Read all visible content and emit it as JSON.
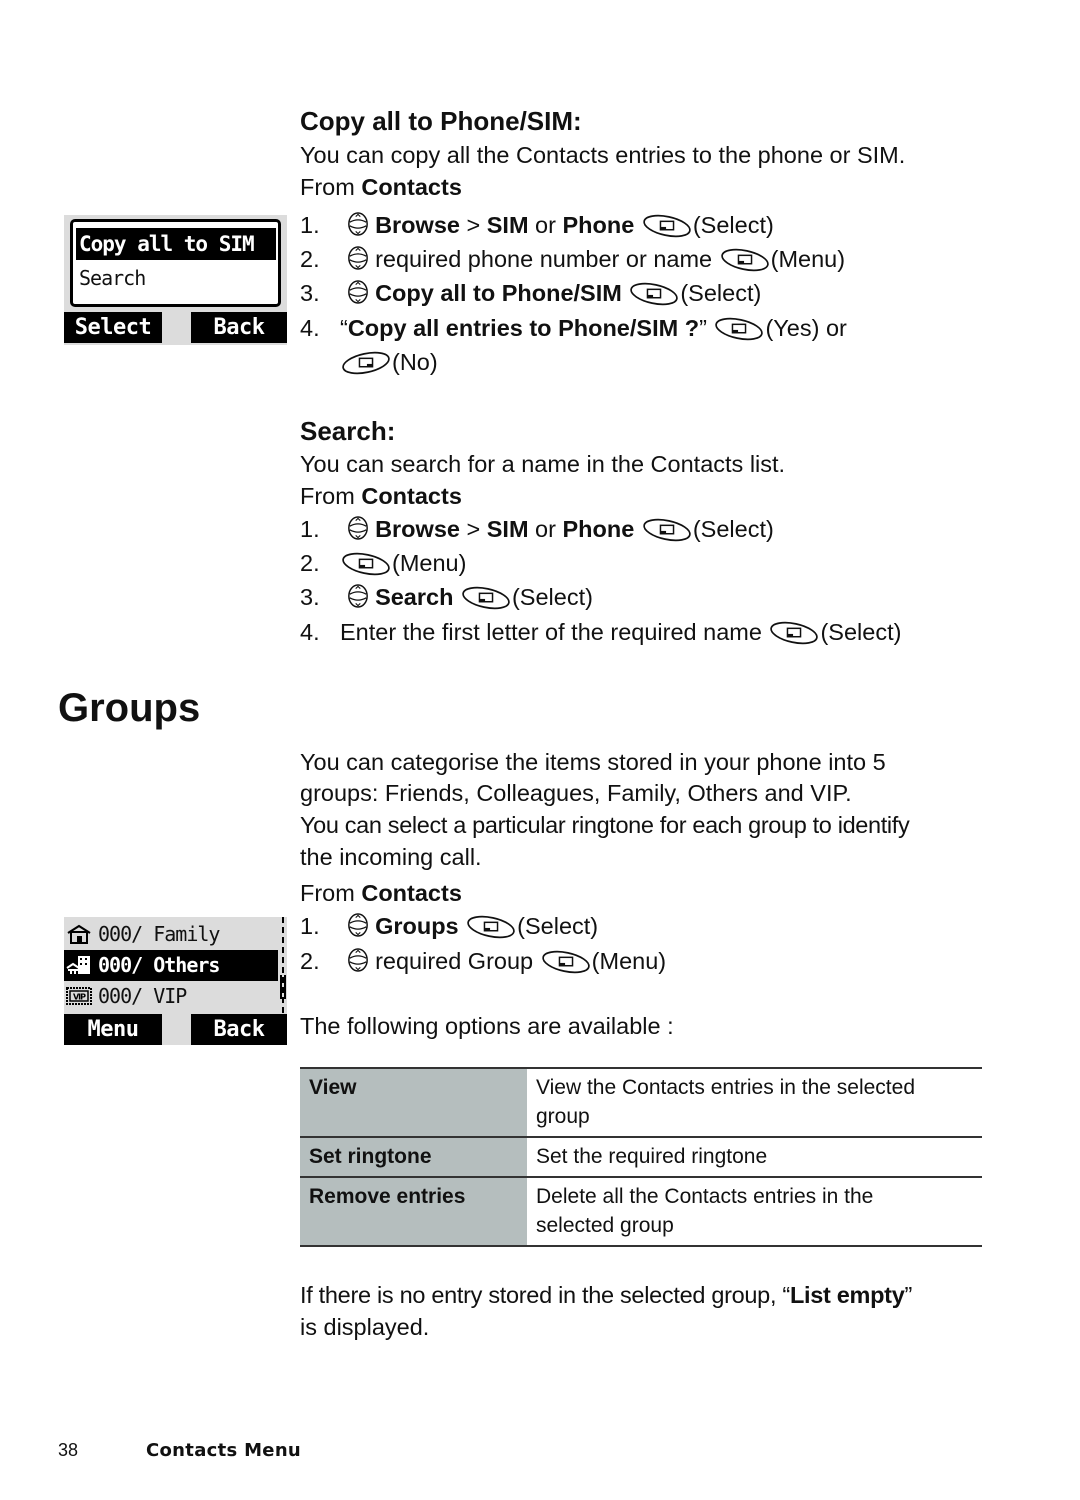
{
  "copy_section": {
    "heading": "Copy all to Phone/SIM:",
    "intro": "You can copy all the Contacts entries to the phone or SIM.",
    "from_prefix": "From ",
    "from_bold": "Contacts",
    "steps": [
      {
        "num": "1.",
        "nav_icon": "navigation-key-icon",
        "parts": [
          [
            "b",
            "Browse"
          ],
          [
            "t",
            " > "
          ],
          [
            "b",
            "SIM"
          ],
          [
            "t",
            " or "
          ],
          [
            "b",
            "Phone"
          ]
        ],
        "softkey": "left-softkey-icon",
        "action": "(Select)"
      },
      {
        "num": "2.",
        "nav_icon": "navigation-key-icon",
        "parts": [
          [
            "t",
            "required phone number or name"
          ]
        ],
        "softkey": "left-softkey-icon",
        "action": "(Menu)"
      },
      {
        "num": "3.",
        "nav_icon": "navigation-key-icon",
        "parts": [
          [
            "b",
            "Copy all to Phone/SIM"
          ]
        ],
        "softkey": "left-softkey-icon",
        "action": "(Select)"
      },
      {
        "num": "4.",
        "quote_open": "“",
        "bold": "Copy all entries to Phone/SIM ?",
        "quote_close": "”",
        "softkey": "left-softkey-icon",
        "action": "(Yes) or",
        "second_softkey": "right-softkey-icon",
        "second_action": "(No)"
      }
    ],
    "screen": {
      "highlighted": "Copy all to SIM",
      "item": "Search",
      "left_softkey": "Select",
      "right_softkey": "Back"
    }
  },
  "search_section": {
    "heading": "Search:",
    "intro": "You can search for a name in the Contacts list.",
    "from_prefix": "From ",
    "from_bold": "Contacts",
    "steps": [
      {
        "num": "1.",
        "bold1": "Browse",
        "sep": " > ",
        "bold2": "SIM",
        "or": " or ",
        "bold3": "Phone",
        "action": "(Select)"
      },
      {
        "num": "2.",
        "action": "(Menu)"
      },
      {
        "num": "3.",
        "bold": "Search",
        "action": "(Select)"
      },
      {
        "num": "4.",
        "text": "Enter the first letter of the required name",
        "action": "(Select)"
      }
    ]
  },
  "groups_section": {
    "heading": "Groups",
    "para1": "You can categorise the items stored in your phone into 5 groups: Friends, Colleagues, Family, Others and VIP.",
    "para1_line1": "You can categorise the items stored in your phone into 5",
    "para1_line2": "groups: Friends, Colleagues, Family, Others and VIP.",
    "para2_line1": "You can select a particular ringtone for each group to identify",
    "para2_line2": "the incoming call.",
    "from_prefix": "From ",
    "from_bold": "Contacts",
    "steps": [
      {
        "num": "1.",
        "bold": "Groups",
        "action": "(Select)"
      },
      {
        "num": "2.",
        "text": "required Group",
        "action": "(Menu)"
      }
    ],
    "options_intro": "The following options are available :",
    "options": [
      {
        "name": "View",
        "desc_line1": "View the Contacts entries in the selected",
        "desc_line2": "group"
      },
      {
        "name": "Set ringtone",
        "desc_line1": "Set the required ringtone",
        "desc_line2": ""
      },
      {
        "name": "Remove entries",
        "desc_line1": "Delete all the Contacts entries in the",
        "desc_line2": "selected group"
      }
    ],
    "note_prefix": "If there is no entry stored in the selected group, “",
    "note_bold": "List empty",
    "note_suffix": "”",
    "note_line2": "is displayed.",
    "screen": {
      "rows": [
        {
          "icon": "family-group-icon",
          "text": "000/ Family",
          "selected": false
        },
        {
          "icon": "others-group-icon",
          "text": "000/ Others",
          "selected": true
        },
        {
          "icon": "vip-group-icon",
          "text": "000/ VIP",
          "selected": false
        }
      ],
      "left_softkey": "Menu",
      "right_softkey": "Back"
    }
  },
  "footer": {
    "page_number": "38",
    "section_title": "Contacts Menu"
  }
}
